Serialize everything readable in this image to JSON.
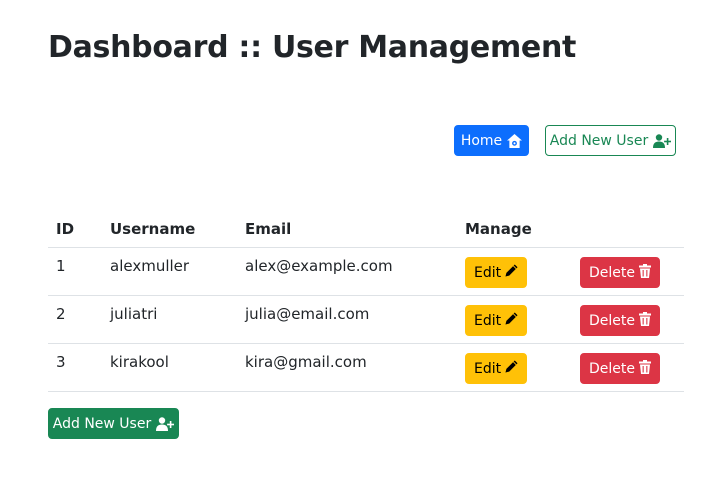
{
  "page": {
    "title": "Dashboard :: User Management"
  },
  "toolbar": {
    "home_label": "Home",
    "home_icon": "house-gear-icon",
    "add_user_label": "Add New User",
    "add_user_icon": "person-plus-icon"
  },
  "table": {
    "headers": [
      "ID",
      "Username",
      "Email",
      "Manage",
      ""
    ],
    "rows": [
      {
        "id": "1",
        "username": "alexmuller",
        "email": "alex@example.com",
        "edit_label": "Edit",
        "delete_label": "Delete"
      },
      {
        "id": "2",
        "username": "juliatri",
        "email": "julia@email.com",
        "edit_label": "Edit",
        "delete_label": "Delete"
      },
      {
        "id": "3",
        "username": "kirakool",
        "email": "kira@gmail.com",
        "edit_label": "Edit",
        "delete_label": "Delete"
      }
    ],
    "edit_icon": "pencil-icon",
    "delete_icon": "trash-icon"
  },
  "footer": {
    "add_user_label": "Add New User"
  },
  "colors": {
    "primary": "#0d6efd",
    "success": "#198754",
    "warning": "#ffc107",
    "danger": "#dc3545",
    "border": "#dee2e6",
    "text": "#212529"
  }
}
